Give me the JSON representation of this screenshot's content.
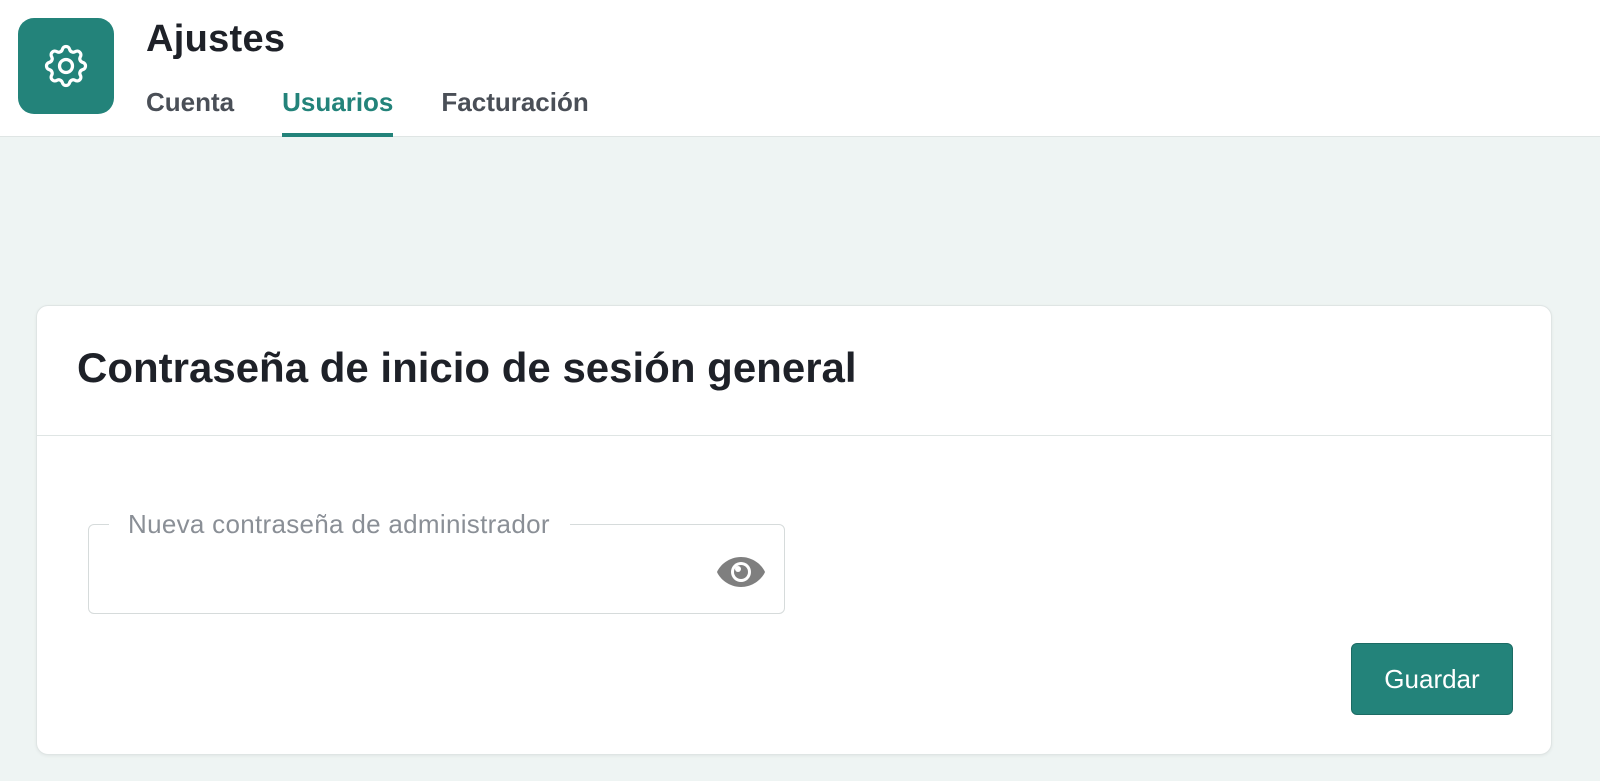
{
  "header": {
    "app_icon": "gear-icon",
    "title": "Ajustes",
    "tabs": [
      {
        "label": "Cuenta",
        "active": false
      },
      {
        "label": "Usuarios",
        "active": true
      },
      {
        "label": "Facturación",
        "active": false
      }
    ]
  },
  "card": {
    "title": "Contraseña de inicio de sesión general",
    "password_field": {
      "label": "Nueva contraseña de administrador",
      "value": "",
      "toggle_icon": "eye-icon"
    },
    "save_label": "Guardar"
  },
  "colors": {
    "accent": "#23837a",
    "background": "#eef4f3",
    "text": "#1e2128"
  }
}
